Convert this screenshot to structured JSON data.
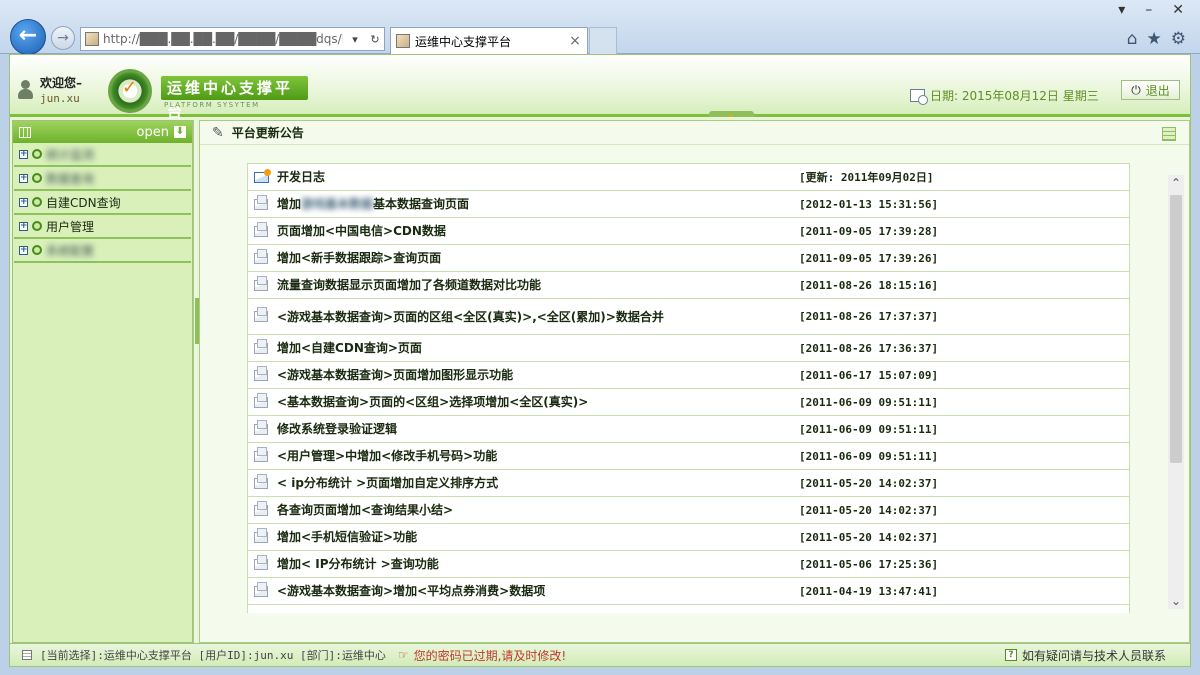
{
  "browser": {
    "address": "http://███.██.██.██/████/████dqs/login.do",
    "tab_title": "运维中心支撑平台",
    "back_glyph": "←",
    "forward_glyph": "→"
  },
  "header": {
    "welcome_label": "欢迎您–",
    "username": "jun.xu",
    "brand_title": "运维中心支撑平台",
    "brand_subtitle": "PLATFORM SYSYTEM",
    "date_text": "日期: 2015年08月12日 星期三",
    "logout_label": "退出"
  },
  "sidebar": {
    "open_label": "open",
    "items": [
      {
        "label": "统计监测",
        "blurred": true
      },
      {
        "label": "数据查询",
        "blurred": true
      },
      {
        "label": "自建CDN查询",
        "blurred": false
      },
      {
        "label": "用户管理",
        "blurred": false
      },
      {
        "label": "系统配置",
        "blurred": true
      }
    ]
  },
  "main": {
    "panel_title": "平台更新公告",
    "log_header": {
      "title": "开发日志",
      "time": "[更新: 2011年09月02日]"
    },
    "rows": [
      {
        "pre": "增加",
        "blur": "游戏基本数据",
        "post": "基本数据查询页面",
        "time": "[2012-01-13 15:31:56]"
      },
      {
        "pre": "页面增加<中国电信>CDN数据",
        "blur": "",
        "post": "",
        "time": "[2011-09-05 17:39:28]"
      },
      {
        "pre": "增加<新手数据跟踪>查询页面",
        "blur": "",
        "post": "",
        "time": "[2011-09-05 17:39:26]"
      },
      {
        "pre": "流量查询数据显示页面增加了各频道数据对比功能",
        "blur": "",
        "post": "",
        "time": "[2011-08-26 18:15:16]"
      },
      {
        "pre": "<游戏基本数据查询>页面的区组<全区(真实)>,<全区(累加)>数据合并",
        "blur": "",
        "post": "",
        "time": "[2011-08-26 17:37:37]",
        "tall": true
      },
      {
        "pre": "增加<自建CDN查询>页面",
        "blur": "",
        "post": "",
        "time": "[2011-08-26 17:36:37]"
      },
      {
        "pre": "<游戏基本数据查询>页面增加图形显示功能",
        "blur": "",
        "post": "",
        "time": "[2011-06-17 15:07:09]"
      },
      {
        "pre": "<基本数据查询>页面的<区组>选择项增加<全区(真实)>",
        "blur": "",
        "post": "",
        "time": "[2011-06-09 09:51:11]"
      },
      {
        "pre": "修改系统登录验证逻辑",
        "blur": "",
        "post": "",
        "time": "[2011-06-09 09:51:11]"
      },
      {
        "pre": "<用户管理>中增加<修改手机号码>功能",
        "blur": "",
        "post": "",
        "time": "[2011-06-09 09:51:11]"
      },
      {
        "pre": "< ip分布统计 >页面增加自定义排序方式",
        "blur": "",
        "post": "",
        "time": "[2011-05-20 14:02:37]"
      },
      {
        "pre": "各查询页面增加<查询结果小结>",
        "blur": "",
        "post": "",
        "time": "[2011-05-20 14:02:37]"
      },
      {
        "pre": "增加<手机短信验证>功能",
        "blur": "",
        "post": "",
        "time": "[2011-05-20 14:02:37]"
      },
      {
        "pre": "增加< IP分布统计 >查询功能",
        "blur": "",
        "post": "",
        "time": "[2011-05-06 17:25:36]"
      },
      {
        "pre": "<游戏基本数据查询>增加<平均点券消费>数据项",
        "blur": "",
        "post": "",
        "time": "[2011-04-19 13:47:41]"
      }
    ]
  },
  "statusbar": {
    "selection_text": "[当前选择]:运维中心支撑平台 [用户ID]:jun.xu [部门]:运维中心",
    "warning_text": "您的密码已过期,请及时修改!",
    "help_text": "如有疑问请与技术人员联系"
  },
  "colors": {
    "accent": "#6fb22c",
    "warning": "#c0392b",
    "date": "#5e8f23"
  }
}
